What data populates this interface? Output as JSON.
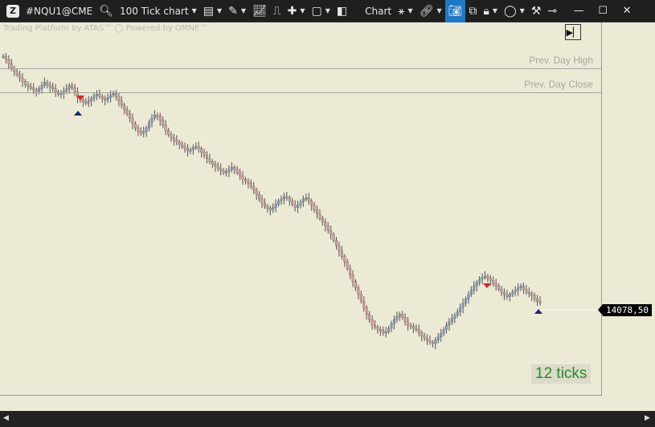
{
  "toolbar": {
    "symbol": "#NQU1@CME",
    "timeframe": "100 Tick chart",
    "chart_label": "Chart",
    "icons": [
      "logo-icon",
      "search-icon",
      "indicators-icon",
      "drawing-pencil-icon",
      "line-chart-icon",
      "template-icon",
      "crosshair-icon",
      "layout-icon",
      "panels-icon",
      "trade-marks-icon",
      "link-icon",
      "camera-icon",
      "copy-icon",
      "lock-icon",
      "circle-icon",
      "tools-icon",
      "pin-icon"
    ],
    "window": {
      "minimize": "—",
      "maximize": "☐",
      "close": "✕"
    }
  },
  "chart": {
    "watermark": "Trading Platform by ATAS™  ◯ Powered by OMNE™",
    "prev_day_high": "Prev. Day High",
    "prev_day_close": "Prev. Day Close",
    "price_tag": "14078,50",
    "ticks_label": "12 ticks",
    "colors": {
      "bg": "#ece9d5",
      "up": "#7e9dc4",
      "down": "#d99a96",
      "sell_marker": "#e22222",
      "buy_marker": "#1a2a7a"
    }
  },
  "chart_data": {
    "type": "candlestick",
    "close_series": [
      1,
      4,
      8,
      12,
      15,
      18,
      21,
      24,
      27,
      29,
      30,
      32,
      33,
      31,
      28,
      25,
      27,
      29,
      31,
      34,
      36,
      35,
      33,
      31,
      28,
      30,
      34,
      39,
      41,
      43,
      44,
      42,
      40,
      37,
      36,
      38,
      40,
      41,
      39,
      37,
      35,
      38,
      42,
      46,
      50,
      54,
      58,
      63,
      67,
      70,
      72,
      70,
      67,
      62,
      58,
      55,
      56,
      60,
      64,
      69,
      73,
      76,
      78,
      80,
      82,
      84,
      86,
      88,
      87,
      85,
      84,
      86,
      89,
      92,
      95,
      98,
      100,
      102,
      104,
      106,
      108,
      107,
      105,
      103,
      105,
      108,
      111,
      114,
      116,
      118,
      121,
      124,
      128,
      132,
      136,
      139,
      141,
      142,
      140,
      137,
      134,
      132,
      130,
      131,
      134,
      137,
      140,
      138,
      135,
      132,
      131,
      134,
      138,
      142,
      146,
      150,
      153,
      157,
      161,
      165,
      170,
      175,
      180,
      185,
      190,
      196,
      202,
      208,
      214,
      220,
      226,
      232,
      238,
      243,
      248,
      250,
      252,
      253,
      255,
      254,
      251,
      247,
      243,
      240,
      238,
      241,
      245,
      248,
      249,
      251,
      252,
      255,
      258,
      260,
      262,
      264,
      265,
      262,
      259,
      256,
      252,
      248,
      245,
      242,
      239,
      236,
      232,
      228,
      224,
      220,
      216,
      212,
      209,
      206,
      204,
      203,
      205,
      207,
      210,
      212,
      215,
      218,
      220,
      222,
      220,
      218,
      216,
      214,
      212,
      215,
      218,
      219,
      221,
      224,
      226,
      228
    ]
  }
}
